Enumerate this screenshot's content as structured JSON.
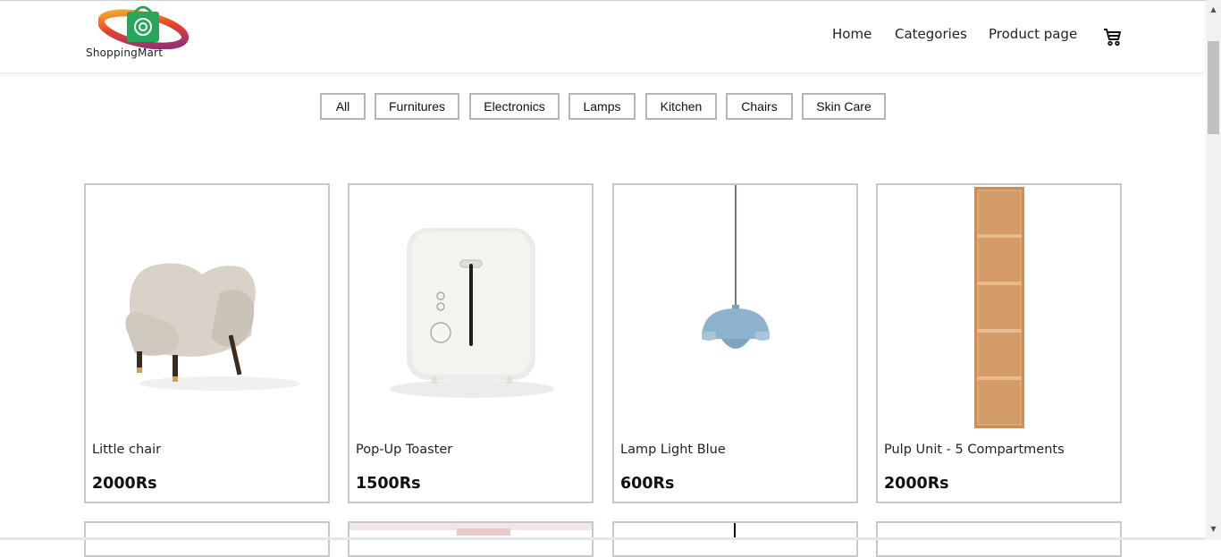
{
  "brand": {
    "name": "ShoppingMart"
  },
  "nav": {
    "home": "Home",
    "categories": "Categories",
    "product_page": "Product page",
    "cart_icon": "shopping-cart-icon"
  },
  "filters": [
    "All",
    "Furnitures",
    "Electronics",
    "Lamps",
    "Kitchen",
    "Chairs",
    "Skin Care"
  ],
  "products": [
    {
      "name": "Little chair",
      "price": "2000Rs",
      "image": "armchair"
    },
    {
      "name": "Pop-Up Toaster",
      "price": "1500Rs",
      "image": "toaster"
    },
    {
      "name": "Lamp Light Blue",
      "price": "600Rs",
      "image": "pendant-lamp"
    },
    {
      "name": "Pulp Unit - 5 Compartments",
      "price": "2000Rs",
      "image": "shelf-unit"
    }
  ],
  "colors": {
    "border": "#c8c8c8",
    "filter_border": "#b5b5b5",
    "lamp_blue": "#8eb3cc",
    "shelf_wood": "#d9a06c"
  }
}
